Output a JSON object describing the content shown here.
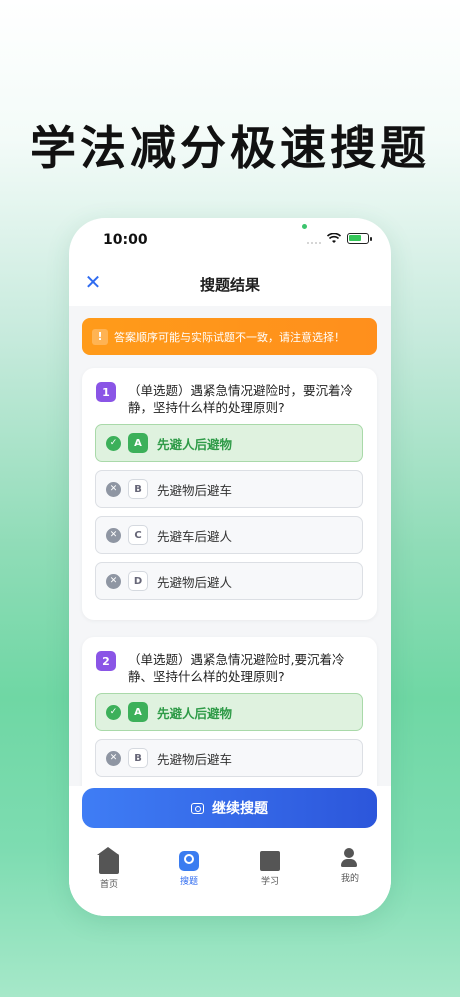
{
  "headline": "学法减分极速搜题",
  "status_bar": {
    "time": "10:00"
  },
  "navbar": {
    "title": "搜题结果",
    "close_icon": "close-icon"
  },
  "warning": {
    "icon": "!",
    "text": "答案顺序可能与实际试题不一致，请注意选择！"
  },
  "questions": [
    {
      "number": "1",
      "text": "（单选题）遇紧急情况避险时，要沉着冷静，坚持什么样的处理原则?",
      "options": [
        {
          "letter": "A",
          "text": "先避人后避物",
          "state": "correct",
          "state_icon": "✓"
        },
        {
          "letter": "B",
          "text": "先避物后避车",
          "state": "wrong",
          "state_icon": "✕"
        },
        {
          "letter": "C",
          "text": "先避车后避人",
          "state": "wrong",
          "state_icon": "✕"
        },
        {
          "letter": "D",
          "text": "先避物后避人",
          "state": "wrong",
          "state_icon": "✕"
        }
      ]
    },
    {
      "number": "2",
      "text": "（单选题）遇紧急情况避险时,要沉着冷静、坚持什么样的处理原则?",
      "options": [
        {
          "letter": "A",
          "text": "先避人后避物",
          "state": "correct",
          "state_icon": "✓"
        },
        {
          "letter": "B",
          "text": "先避物后避车",
          "state": "wrong",
          "state_icon": "✕"
        }
      ]
    }
  ],
  "continue_button": {
    "label": "继续搜题"
  },
  "tabs": [
    {
      "label": "首页",
      "icon": "home-icon",
      "active": false
    },
    {
      "label": "搜题",
      "icon": "camera-search-icon",
      "active": true
    },
    {
      "label": "学习",
      "icon": "monitor-icon",
      "active": false
    },
    {
      "label": "我的",
      "icon": "user-icon",
      "active": false
    }
  ],
  "colors": {
    "accent": "#2f6bf0",
    "correct": "#3cb05a",
    "warning": "#ff9b1a",
    "question_badge": "#8a55e6"
  }
}
